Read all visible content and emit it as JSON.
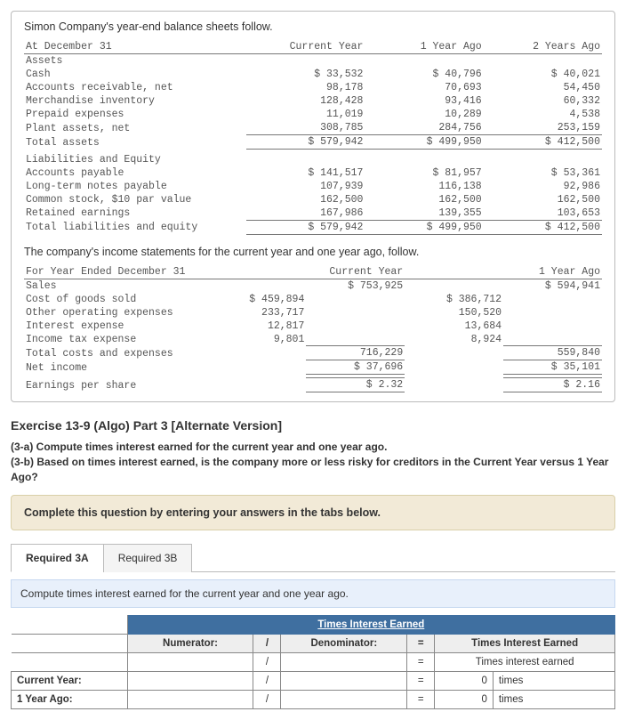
{
  "bs": {
    "intro": "Simon Company's year-end balance sheets follow.",
    "col0": "At December 31",
    "assets_hdr": "Assets",
    "c1": "Current Year",
    "c2": "1 Year Ago",
    "c3": "2 Years Ago",
    "cash_l": "Cash",
    "cash1": "$ 33,532",
    "cash2": "$ 40,796",
    "cash3": "$ 40,021",
    "ar_l": "Accounts receivable, net",
    "ar1": "98,178",
    "ar2": "70,693",
    "ar3": "54,450",
    "inv_l": "Merchandise inventory",
    "inv1": "128,428",
    "inv2": "93,416",
    "inv3": "60,332",
    "pre_l": "Prepaid expenses",
    "pre1": "11,019",
    "pre2": "10,289",
    "pre3": "4,538",
    "pa_l": "Plant assets, net",
    "pa1": "308,785",
    "pa2": "284,756",
    "pa3": "253,159",
    "ta_l": "Total assets",
    "ta1": "$ 579,942",
    "ta2": "$ 499,950",
    "ta3": "$ 412,500",
    "le_hdr": "Liabilities and Equity",
    "ap_l": "Accounts payable",
    "ap1": "$ 141,517",
    "ap2": "$ 81,957",
    "ap3": "$ 53,361",
    "ltn_l": "Long-term notes payable",
    "ltn1": "107,939",
    "ltn2": "116,138",
    "ltn3": "92,986",
    "cs_l": "Common stock, $10 par value",
    "cs1": "162,500",
    "cs2": "162,500",
    "cs3": "162,500",
    "re_l": "Retained earnings",
    "re1": "167,986",
    "re2": "139,355",
    "re3": "103,653",
    "tle_l": "Total liabilities and equity",
    "tle1": "$ 579,942",
    "tle2": "$ 499,950",
    "tle3": "$ 412,500"
  },
  "is": {
    "intro": "The company's income statements for the current year and one year ago, follow.",
    "col0": "For Year Ended December 31",
    "c1": "Current Year",
    "c2": "1 Year Ago",
    "sales_l": "Sales",
    "sales1": "$ 753,925",
    "sales2": "$ 594,941",
    "cogs_l": "Cost of goods sold",
    "cogs1": "$ 459,894",
    "cogs2": "$ 386,712",
    "ooe_l": "Other operating expenses",
    "ooe1": "233,717",
    "ooe2": "150,520",
    "int_l": "Interest expense",
    "int1": "12,817",
    "int2": "13,684",
    "tax_l": "Income tax expense",
    "tax1": "9,801",
    "tax2": "8,924",
    "tce_l": "Total costs and expenses",
    "tce1": "716,229",
    "tce2": "559,840",
    "ni_l": "Net income",
    "ni1": "$ 37,696",
    "ni2": "$ 35,101",
    "eps_l": "Earnings per share",
    "eps1": "$ 2.32",
    "eps2": "$ 2.16"
  },
  "ex": {
    "title": "Exercise 13-9 (Algo) Part 3 [Alternate Version]",
    "qa": "(3-a) Compute times interest earned for the current year and one year ago.",
    "qb": "(3-b) Based on times interest earned, is the company more or less risky for creditors in the Current Year versus 1 Year Ago?",
    "complete": "Complete this question by entering your answers in the tabs below.",
    "tab1": "Required 3A",
    "tab2": "Required 3B",
    "instr": "Compute times interest earned for the current year and one year ago."
  },
  "ans": {
    "title": "Times Interest Earned",
    "numerator": "Numerator:",
    "denominator": "Denominator:",
    "tie_hdr": "Times Interest Earned",
    "tie_sub": "Times interest earned",
    "slash": "/",
    "eq": "=",
    "row1": "Current Year:",
    "row2": "1 Year Ago:",
    "val": "0",
    "unit": "times"
  }
}
